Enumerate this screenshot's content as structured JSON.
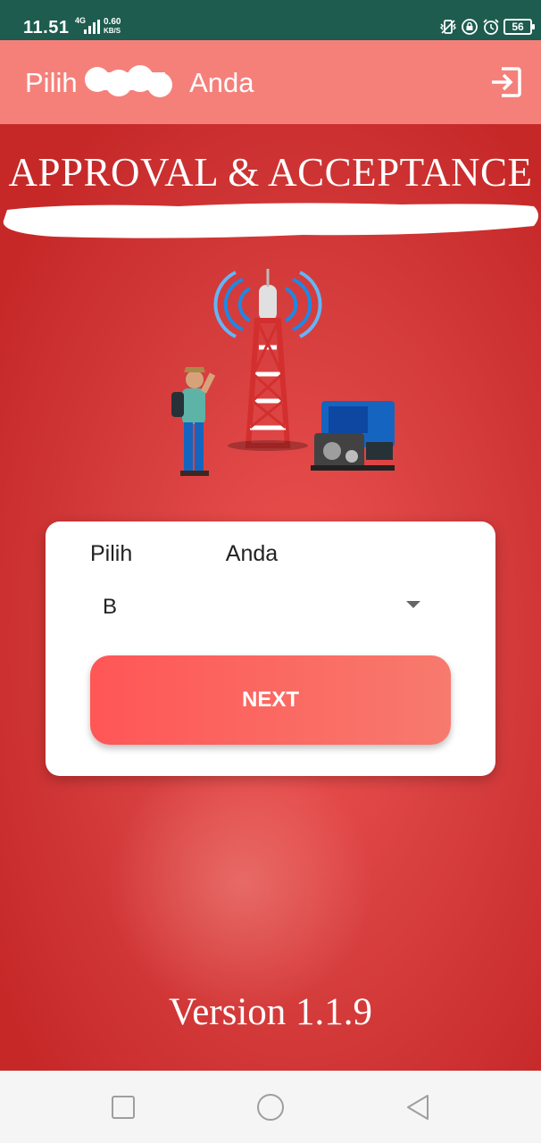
{
  "status_bar": {
    "time": "11.51",
    "network": "4G",
    "speed_value": "0.60",
    "speed_unit": "KB/S",
    "battery": "56",
    "icons": [
      "signal-icon",
      "vibrate-icon",
      "lock-rotation-icon",
      "alarm-icon",
      "battery-icon"
    ]
  },
  "app_bar": {
    "title_prefix": "Pilih",
    "title_suffix": "Anda",
    "logout_icon": "logout-icon"
  },
  "banner": {
    "headline": "APPROVAL & ACCEPTANCE"
  },
  "form": {
    "label_prefix": "Pilih",
    "label_suffix": "Anda",
    "selected_value": "B",
    "next_label": "NEXT"
  },
  "footer": {
    "version": "Version 1.1.9"
  },
  "nav_bar": {
    "buttons": [
      "recents-icon",
      "home-icon",
      "back-icon"
    ]
  },
  "colors": {
    "status_bar": "#1d5c4e",
    "app_bar": "#f5807a",
    "background": "#c62828",
    "button_start": "#ff5656",
    "button_end": "#f77a6e"
  }
}
